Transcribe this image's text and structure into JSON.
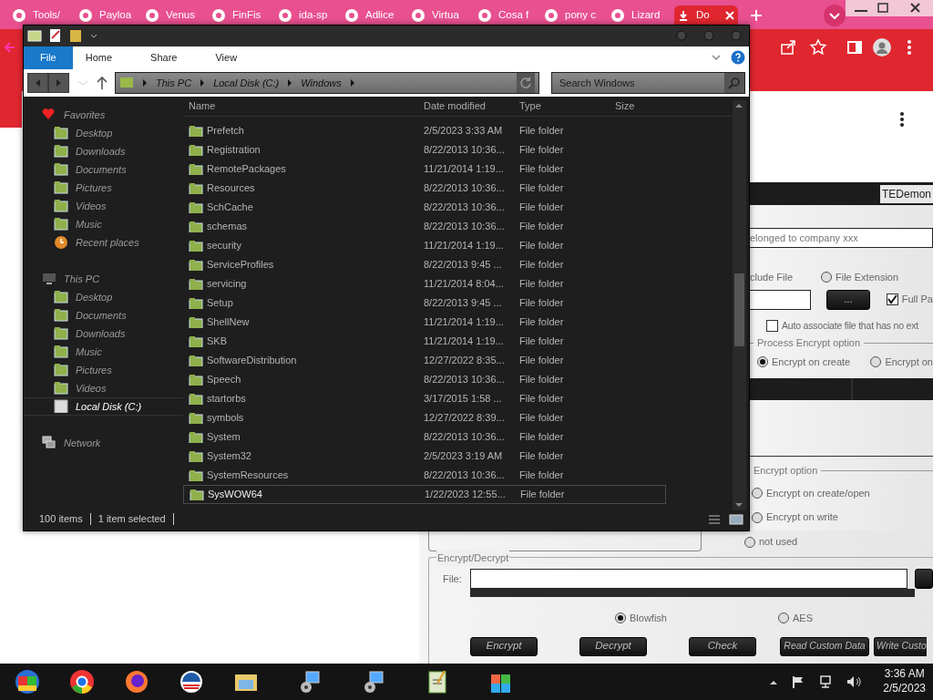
{
  "browser": {
    "tabs": [
      {
        "label": "Tools/",
        "selected": false
      },
      {
        "label": "Payloa",
        "selected": false
      },
      {
        "label": "Venus",
        "selected": false
      },
      {
        "label": "FinFis",
        "selected": false
      },
      {
        "label": "ida-sp",
        "selected": false
      },
      {
        "label": "Adlice",
        "selected": false
      },
      {
        "label": "Virtua",
        "selected": false
      },
      {
        "label": "Cosa f",
        "selected": false
      },
      {
        "label": "pony c",
        "selected": false
      },
      {
        "label": "Lizard",
        "selected": false
      },
      {
        "label": "Do",
        "selected": true
      }
    ]
  },
  "explorer": {
    "ribbon_tabs": [
      {
        "label": "File",
        "selected": true
      },
      {
        "label": "Home",
        "selected": false
      },
      {
        "label": "Share",
        "selected": false
      },
      {
        "label": "View",
        "selected": false
      }
    ],
    "breadcrumb": [
      "This PC",
      "Local Disk (C:)",
      "Windows"
    ],
    "search": {
      "placeholder": "Search Windows"
    },
    "sidebar": [
      {
        "label": "Favorites",
        "children": [
          {
            "label": "Desktop",
            "selected": false
          },
          {
            "label": "Downloads",
            "selected": false
          },
          {
            "label": "Documents",
            "selected": false
          },
          {
            "label": "Pictures",
            "selected": false
          },
          {
            "label": "Videos",
            "selected": false
          },
          {
            "label": "Music",
            "selected": false
          },
          {
            "label": "Recent places",
            "selected": false
          }
        ]
      },
      {
        "label": "This PC",
        "children": [
          {
            "label": "Desktop",
            "selected": false
          },
          {
            "label": "Documents",
            "selected": false
          },
          {
            "label": "Downloads",
            "selected": false
          },
          {
            "label": "Music",
            "selected": false
          },
          {
            "label": "Pictures",
            "selected": false
          },
          {
            "label": "Videos",
            "selected": false
          },
          {
            "label": "Local Disk (C:)",
            "selected": true
          }
        ]
      },
      {
        "label": "Network"
      }
    ],
    "columns": [
      "Name",
      "Date modified",
      "Type",
      "Size"
    ],
    "rows": [
      {
        "name": "Prefetch",
        "date": "2/5/2023 3:33 AM",
        "type": "File folder",
        "selected": false
      },
      {
        "name": "Registration",
        "date": "8/22/2013 10:36...",
        "type": "File folder",
        "selected": false
      },
      {
        "name": "RemotePackages",
        "date": "11/21/2014 1:19...",
        "type": "File folder",
        "selected": false
      },
      {
        "name": "Resources",
        "date": "8/22/2013 10:36...",
        "type": "File folder",
        "selected": false
      },
      {
        "name": "SchCache",
        "date": "8/22/2013 10:36...",
        "type": "File folder",
        "selected": false
      },
      {
        "name": "schemas",
        "date": "8/22/2013 10:36...",
        "type": "File folder",
        "selected": false
      },
      {
        "name": "security",
        "date": "11/21/2014 1:19...",
        "type": "File folder",
        "selected": false
      },
      {
        "name": "ServiceProfiles",
        "date": "8/22/2013 9:45 ...",
        "type": "File folder",
        "selected": false
      },
      {
        "name": "servicing",
        "date": "11/21/2014 8:04...",
        "type": "File folder",
        "selected": false
      },
      {
        "name": "Setup",
        "date": "8/22/2013 9:45 ...",
        "type": "File folder",
        "selected": false
      },
      {
        "name": "ShellNew",
        "date": "11/21/2014 1:19...",
        "type": "File folder",
        "selected": false
      },
      {
        "name": "SKB",
        "date": "11/21/2014 1:19...",
        "type": "File folder",
        "selected": false
      },
      {
        "name": "SoftwareDistribution",
        "date": "12/27/2022 8:35...",
        "type": "File folder",
        "selected": false
      },
      {
        "name": "Speech",
        "date": "8/22/2013 10:36...",
        "type": "File folder",
        "selected": false
      },
      {
        "name": "startorbs",
        "date": "3/17/2015 1:58 ...",
        "type": "File folder",
        "selected": false
      },
      {
        "name": "symbols",
        "date": "12/27/2022 8:39...",
        "type": "File folder",
        "selected": false
      },
      {
        "name": "System",
        "date": "8/22/2013 10:36...",
        "type": "File folder",
        "selected": false
      },
      {
        "name": "System32",
        "date": "2/5/2023 3:19 AM",
        "type": "File folder",
        "selected": false
      },
      {
        "name": "SystemResources",
        "date": "8/22/2013 10:36...",
        "type": "File folder",
        "selected": false
      },
      {
        "name": "SysWOW64",
        "date": "1/22/2023 12:55...",
        "type": "File folder",
        "selected": true
      }
    ],
    "status": [
      "100 items",
      "1 item selected"
    ]
  },
  "app": {
    "title": "TEDemon",
    "company_field": {
      "value": "elonged to company xxx"
    },
    "include_file_label": "clude File",
    "file_extension": {
      "label": "File Extension",
      "selected": false
    },
    "browse_button": "...",
    "full_path": {
      "label": "Full Pa",
      "checked": true
    },
    "auto_associate": {
      "label": "Auto associate file that has no ext",
      "checked": false
    },
    "process_encrypt": {
      "title": "Process Encrypt option",
      "options": [
        {
          "label": "Encrypt on create",
          "selected": true
        },
        {
          "label": "Encrypt on",
          "selected": false
        }
      ]
    },
    "encrypt_option": {
      "title": "Encrypt option",
      "options": [
        {
          "label": "Encrypt on create/open",
          "selected": false
        },
        {
          "label": "Encrypt on write",
          "selected": false
        },
        {
          "label": "not used",
          "selected": false
        }
      ]
    },
    "encrypt_decrypt": {
      "title": "Encrypt/Decrypt",
      "file_label": "File:",
      "algorithms": [
        {
          "label": "Blowfish",
          "selected": true
        },
        {
          "label": "AES",
          "selected": false
        }
      ],
      "buttons": [
        "Encrypt",
        "Decrypt",
        "Check",
        "Read Custom Data",
        "Write Custo"
      ]
    }
  },
  "taskbar": {
    "time": "3:36 AM",
    "date": "2/5/2023"
  }
}
